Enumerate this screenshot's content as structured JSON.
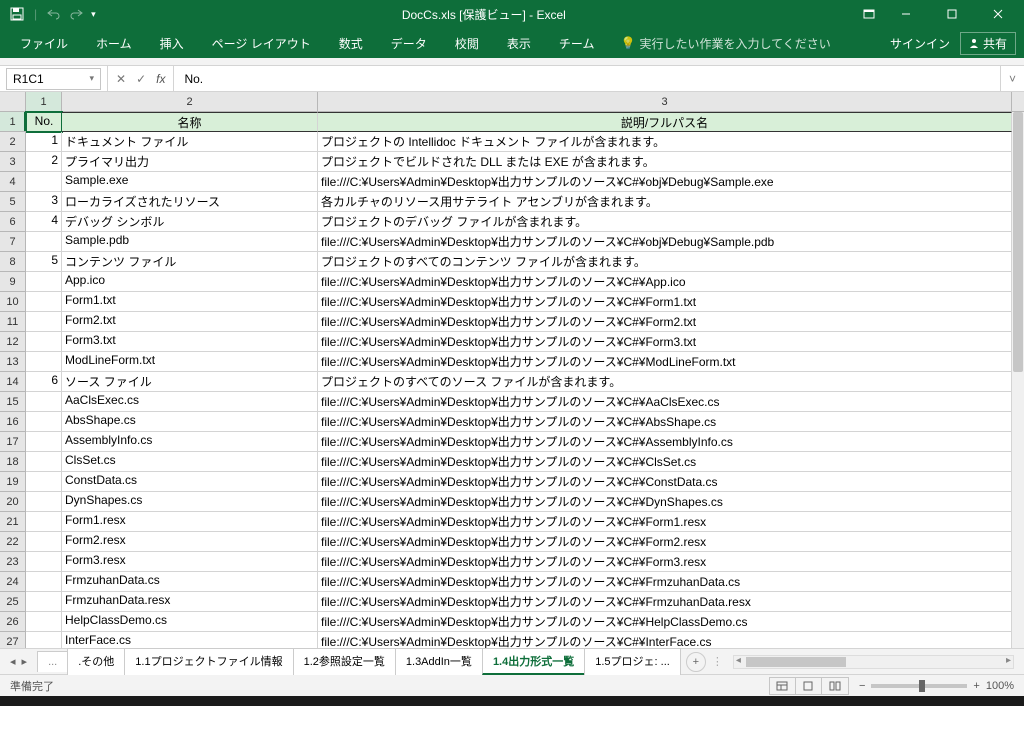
{
  "titlebar": {
    "title": "DocCs.xls [保護ビュー] - Excel"
  },
  "ribbon": {
    "tabs": [
      "ファイル",
      "ホーム",
      "挿入",
      "ページ レイアウト",
      "数式",
      "データ",
      "校閲",
      "表示",
      "チーム"
    ],
    "tell_me": "実行したい作業を入力してください",
    "signin": "サインイン",
    "share": "共有"
  },
  "formula": {
    "namebox": "R1C1",
    "fx": "fx",
    "value": "No."
  },
  "columns": [
    "1",
    "2",
    "3"
  ],
  "headers": {
    "no": "No.",
    "name": "名称",
    "desc": "説明/フルパス名"
  },
  "rows": [
    {
      "r": "1",
      "no": "",
      "name": "",
      "desc": ""
    },
    {
      "r": "2",
      "no": "1",
      "name": "ドキュメント ファイル",
      "desc": "プロジェクトの Intellidoc ドキュメント ファイルが含まれます。"
    },
    {
      "r": "3",
      "no": "2",
      "name": "プライマリ出力",
      "desc": "プロジェクトでビルドされた DLL または EXE が含まれます。"
    },
    {
      "r": "4",
      "no": "",
      "name": "Sample.exe",
      "desc": "file:///C:¥Users¥Admin¥Desktop¥出力サンプルのソース¥C#¥obj¥Debug¥Sample.exe"
    },
    {
      "r": "5",
      "no": "3",
      "name": "ローカライズされたリソース",
      "desc": "各カルチャのリソース用サテライト アセンブリが含まれます。"
    },
    {
      "r": "6",
      "no": "4",
      "name": "デバッグ シンボル",
      "desc": "プロジェクトのデバッグ ファイルが含まれます。"
    },
    {
      "r": "7",
      "no": "",
      "name": "Sample.pdb",
      "desc": "file:///C:¥Users¥Admin¥Desktop¥出力サンプルのソース¥C#¥obj¥Debug¥Sample.pdb"
    },
    {
      "r": "8",
      "no": "5",
      "name": "コンテンツ ファイル",
      "desc": "プロジェクトのすべてのコンテンツ ファイルが含まれます。"
    },
    {
      "r": "9",
      "no": "",
      "name": "App.ico",
      "desc": "file:///C:¥Users¥Admin¥Desktop¥出力サンプルのソース¥C#¥App.ico"
    },
    {
      "r": "10",
      "no": "",
      "name": "Form1.txt",
      "desc": "file:///C:¥Users¥Admin¥Desktop¥出力サンプルのソース¥C#¥Form1.txt"
    },
    {
      "r": "11",
      "no": "",
      "name": "Form2.txt",
      "desc": "file:///C:¥Users¥Admin¥Desktop¥出力サンプルのソース¥C#¥Form2.txt"
    },
    {
      "r": "12",
      "no": "",
      "name": "Form3.txt",
      "desc": "file:///C:¥Users¥Admin¥Desktop¥出力サンプルのソース¥C#¥Form3.txt"
    },
    {
      "r": "13",
      "no": "",
      "name": "ModLineForm.txt",
      "desc": "file:///C:¥Users¥Admin¥Desktop¥出力サンプルのソース¥C#¥ModLineForm.txt"
    },
    {
      "r": "14",
      "no": "6",
      "name": "ソース ファイル",
      "desc": "プロジェクトのすべてのソース ファイルが含まれます。"
    },
    {
      "r": "15",
      "no": "",
      "name": "AaClsExec.cs",
      "desc": "file:///C:¥Users¥Admin¥Desktop¥出力サンプルのソース¥C#¥AaClsExec.cs"
    },
    {
      "r": "16",
      "no": "",
      "name": "AbsShape.cs",
      "desc": "file:///C:¥Users¥Admin¥Desktop¥出力サンプルのソース¥C#¥AbsShape.cs"
    },
    {
      "r": "17",
      "no": "",
      "name": "AssemblyInfo.cs",
      "desc": "file:///C:¥Users¥Admin¥Desktop¥出力サンプルのソース¥C#¥AssemblyInfo.cs"
    },
    {
      "r": "18",
      "no": "",
      "name": "ClsSet.cs",
      "desc": "file:///C:¥Users¥Admin¥Desktop¥出力サンプルのソース¥C#¥ClsSet.cs"
    },
    {
      "r": "19",
      "no": "",
      "name": "ConstData.cs",
      "desc": "file:///C:¥Users¥Admin¥Desktop¥出力サンプルのソース¥C#¥ConstData.cs"
    },
    {
      "r": "20",
      "no": "",
      "name": "DynShapes.cs",
      "desc": "file:///C:¥Users¥Admin¥Desktop¥出力サンプルのソース¥C#¥DynShapes.cs"
    },
    {
      "r": "21",
      "no": "",
      "name": "Form1.resx",
      "desc": "file:///C:¥Users¥Admin¥Desktop¥出力サンプルのソース¥C#¥Form1.resx"
    },
    {
      "r": "22",
      "no": "",
      "name": "Form2.resx",
      "desc": "file:///C:¥Users¥Admin¥Desktop¥出力サンプルのソース¥C#¥Form2.resx"
    },
    {
      "r": "23",
      "no": "",
      "name": "Form3.resx",
      "desc": "file:///C:¥Users¥Admin¥Desktop¥出力サンプルのソース¥C#¥Form3.resx"
    },
    {
      "r": "24",
      "no": "",
      "name": "FrmzuhanData.cs",
      "desc": "file:///C:¥Users¥Admin¥Desktop¥出力サンプルのソース¥C#¥FrmzuhanData.cs"
    },
    {
      "r": "25",
      "no": "",
      "name": "FrmzuhanData.resx",
      "desc": "file:///C:¥Users¥Admin¥Desktop¥出力サンプルのソース¥C#¥FrmzuhanData.resx"
    },
    {
      "r": "26",
      "no": "",
      "name": "HelpClassDemo.cs",
      "desc": "file:///C:¥Users¥Admin¥Desktop¥出力サンプルのソース¥C#¥HelpClassDemo.cs"
    },
    {
      "r": "27",
      "no": "",
      "name": "InterFace.cs",
      "desc": "file:///C:¥Users¥Admin¥Desktop¥出力サンプルのソース¥C#¥InterFace.cs"
    }
  ],
  "sheets": {
    "ell_left": "...",
    "tabs": [
      ".その他",
      "1.1プロジェクトファイル情報",
      "1.2参照設定一覧",
      "1.3AddIn一覧",
      "1.4出力形式一覧",
      "1.5プロジェ: ..."
    ],
    "active_index": 4
  },
  "status": {
    "ready": "準備完了",
    "zoom": "100%"
  }
}
